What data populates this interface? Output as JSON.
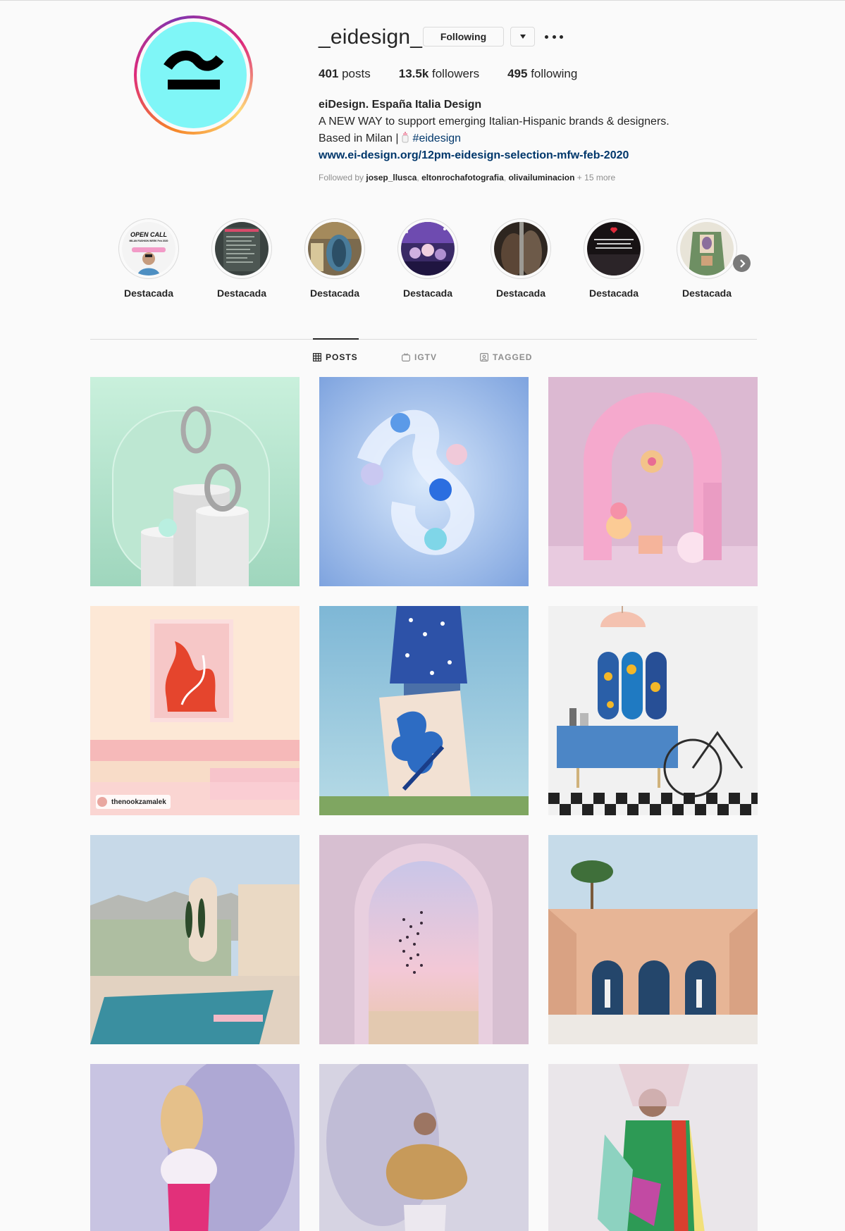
{
  "profile": {
    "username": "_eidesign_",
    "following_button": "Following",
    "avatar_ring_colors": [
      "#f58529",
      "#dd2a7b",
      "#8134af"
    ],
    "avatar_bg": "#7ff6f7",
    "stats": {
      "posts_count": "401",
      "posts_label": " posts",
      "followers_count": "13.5k",
      "followers_label": " followers",
      "following_count": "495",
      "following_label": " following"
    },
    "bio": {
      "name": "eiDesign. España Italia Design",
      "line1": "A NEW WAY to support emerging Italian-Hispanic brands & designers.",
      "line2_prefix": "Based in Milan |",
      "line2_emoji": "baby-bottle-icon",
      "hashtag": "#eidesign",
      "link": "www.ei-design.org/12pm-eidesign-selection-mfw-feb-2020"
    },
    "followed_by": {
      "prefix": "Followed by ",
      "users": [
        "josep_llusca",
        "eltonrochafotografia",
        "olivailuminacion"
      ],
      "more": " + 15 more"
    }
  },
  "highlights": [
    {
      "label": "Destacada",
      "cover_text_1": "OPEN CALL",
      "cover_text_2": "MILAN FASHION WEEK Feb 2020"
    },
    {
      "label": "Destacada"
    },
    {
      "label": "Destacada"
    },
    {
      "label": "Destacada"
    },
    {
      "label": "Destacada"
    },
    {
      "label": "Destacada"
    },
    {
      "label": "Destacada"
    }
  ],
  "tabs": [
    {
      "label": "POSTS",
      "icon": "grid-icon",
      "active": true
    },
    {
      "label": "IGTV",
      "icon": "igtv-icon",
      "active": false
    },
    {
      "label": "TAGGED",
      "icon": "tagged-icon",
      "active": false
    }
  ],
  "posts": {
    "tagged_user": "thenookzamalek",
    "items": [
      "rings-on-marble-pedestals",
      "abstract-blue-spheres",
      "pink-arch-sculpture",
      "flamingo-art-pink-room",
      "man-holding-flower-painting",
      "sideboard-with-skateboards",
      "pool-mediterranean-architecture",
      "arch-desert-butterflies",
      "pink-arches-with-statues",
      "dancer-colorful-dress",
      "woman-ruffled-sculpture",
      "woman-green-plastic-outfit"
    ]
  }
}
